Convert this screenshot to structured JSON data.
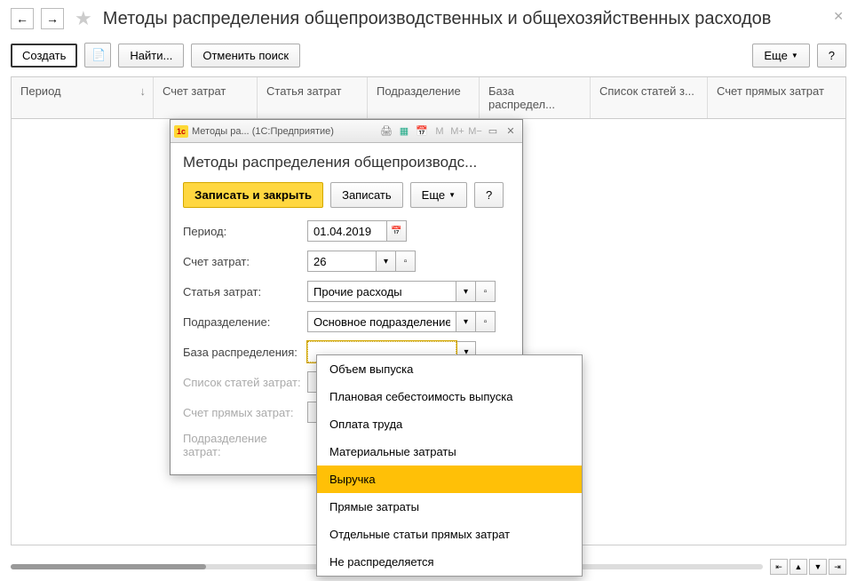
{
  "header": {
    "title": "Методы распределения общепроизводственных и общехозяйственных расходов"
  },
  "toolbar": {
    "create": "Создать",
    "find": "Найти...",
    "cancel_search": "Отменить поиск",
    "more": "Еще",
    "help": "?"
  },
  "table": {
    "columns": [
      "Период",
      "Счет затрат",
      "Статья затрат",
      "Подразделение",
      "База распредел...",
      "Список статей з...",
      "Счет прямых затрат"
    ]
  },
  "dialog": {
    "titlebar_left": "Методы ра...",
    "titlebar_right": "(1С:Предприятие)",
    "title": "Методы распределения общепроизводс...",
    "save_close": "Записать и закрыть",
    "save": "Записать",
    "more": "Еще",
    "help": "?",
    "fields": {
      "period_label": "Период:",
      "period_value": "01.04.2019",
      "account_label": "Счет затрат:",
      "account_value": "26",
      "article_label": "Статья затрат:",
      "article_value": "Прочие расходы",
      "dept_label": "Подразделение:",
      "dept_value": "Основное подразделение",
      "base_label": "База распределения:",
      "base_value": "",
      "list_label": "Список статей затрат:",
      "direct_acc_label": "Счет прямых затрат:",
      "dept_cost_label": "Подразделение затрат:"
    }
  },
  "dropdown": {
    "items": [
      "Объем выпуска",
      "Плановая себестоимость выпуска",
      "Оплата труда",
      "Материальные затраты",
      "Выручка",
      "Прямые затраты",
      "Отдельные статьи прямых затрат",
      "Не распределяется"
    ],
    "selected_index": 4
  }
}
